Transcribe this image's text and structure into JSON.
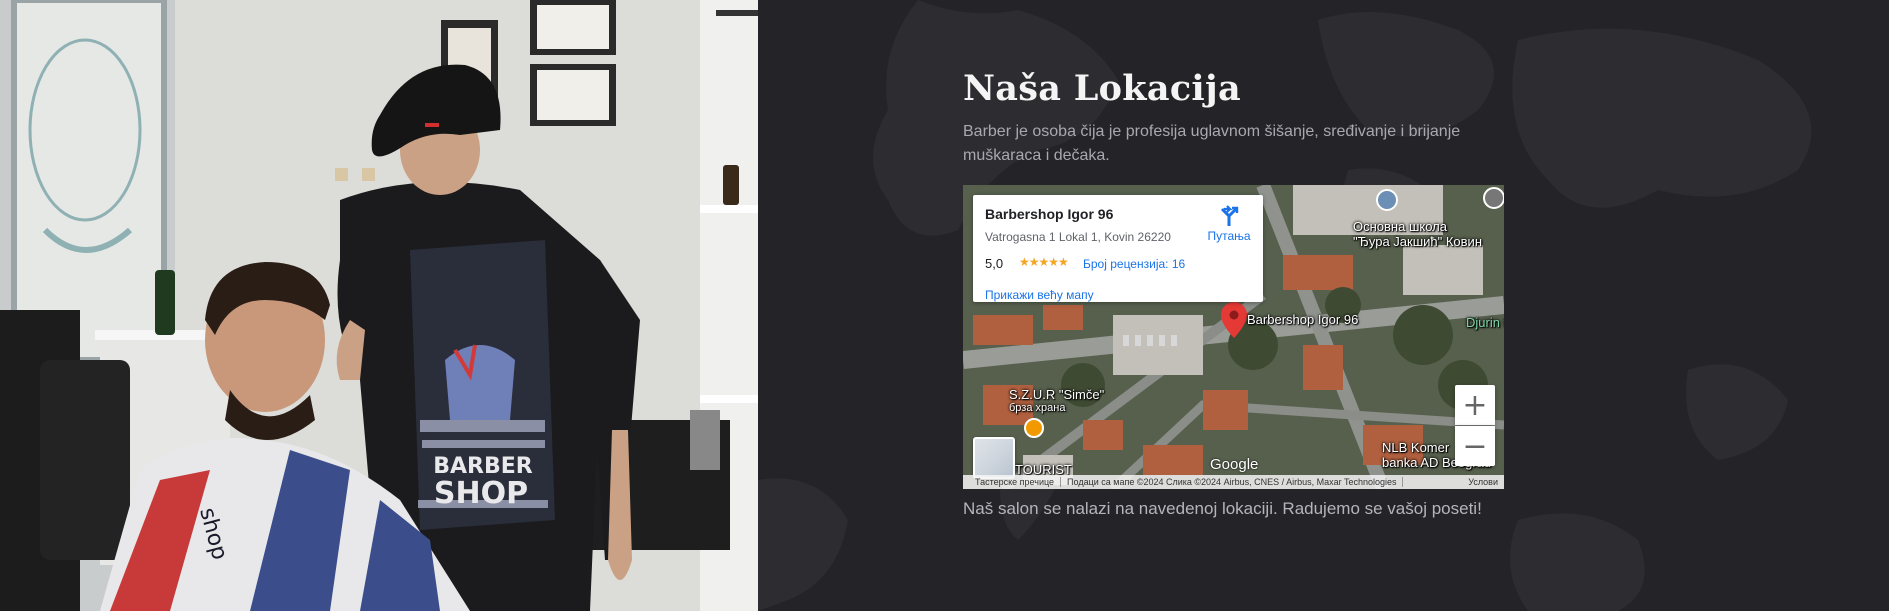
{
  "section": {
    "title": "Naša Lokacija",
    "description": "Barber je osoba čija je profesija uglavnom šišanje, sređivanje i brijanje muškaraca i dečaka.",
    "footer_text": "Naš salon se nalazi na navedenoj lokaciji. Radujemo se vašoj poseti!"
  },
  "photo": {
    "apron_text_1": "BARBER",
    "apron_text_2": "SHOP",
    "cape_text": "shop"
  },
  "map": {
    "place_name": "Barbershop Igor 96",
    "address": "Vatrogasna 1 Lokal 1, Kovin 26220",
    "rating": "5,0",
    "stars": "★★★★★",
    "reviews_link": "Број рецензија: 16",
    "larger_map_link": "Прикажи већу мапу",
    "directions_label": "Путања",
    "pin_label": "Barbershop Igor 96",
    "labels": {
      "school_line1": "Основна школа",
      "school_line2": "\"Ђура Јакшић\" Ковин",
      "djurin": "Djurin te",
      "szur": "S.Z.U.R \"Simče\"",
      "fast_food": "брза храна",
      "tourist": "TOURIST",
      "nlb_line1": "NLB Komer",
      "nlb_line2": "banka AD Beograd"
    },
    "google_logo": "Google",
    "zoom_in": "+",
    "zoom_out": "−",
    "attribution": {
      "shortcuts": "Тастерске пречице",
      "map_data": "Подаци са мапе ©2024 Слика ©2024 Airbus, CNES / Airbus, Maxar Technologies",
      "terms": "Услови"
    }
  },
  "colors": {
    "background": "#242428",
    "title": "#f4f4f4",
    "text": "#a8a8ae",
    "link": "#1a73e8",
    "pin": "#e53935",
    "star": "#f4a623"
  }
}
